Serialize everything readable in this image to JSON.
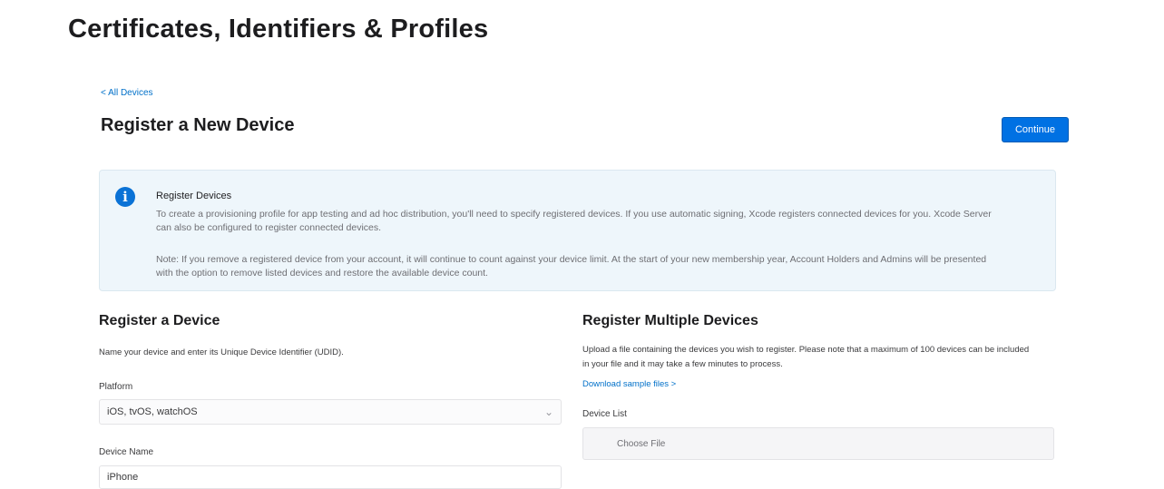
{
  "header": {
    "title": "Certificates, Identifiers & Profiles"
  },
  "nav": {
    "back_label": "< All Devices"
  },
  "page": {
    "section_title": "Register a New Device",
    "continue_label": "Continue"
  },
  "info": {
    "icon": "info-icon",
    "heading": "Register Devices",
    "paragraph1": "To create a provisioning profile for app testing and ad hoc distribution, you'll need to specify registered devices. If you use automatic signing, Xcode registers connected devices for you. Xcode Server can also be configured to register connected devices.",
    "paragraph2": "Note: If you remove a registered device from your account, it will continue to count against your device limit. At the start of your new membership year, Account Holders and Admins will be presented with the option to remove listed devices and restore the available device count.",
    "colors": {
      "background": "#eef6fb",
      "icon": "#0a72d6"
    }
  },
  "register_device": {
    "title": "Register a Device",
    "description": "Name your device and enter its Unique Device Identifier (UDID).",
    "platform_label": "Platform",
    "platform_value": "iOS, tvOS, watchOS",
    "device_name_label": "Device Name",
    "device_name_value": "iPhone"
  },
  "register_multiple": {
    "title": "Register Multiple Devices",
    "description": "Upload a file containing the devices you wish to register. Please note that a maximum of 100 devices can be included in your file and it may take a few minutes to process.",
    "download_link": "Download sample files >",
    "device_list_label": "Device List",
    "choose_file_label": "Choose File"
  },
  "colors": {
    "accent": "#0071e3",
    "link": "#0070c9"
  }
}
